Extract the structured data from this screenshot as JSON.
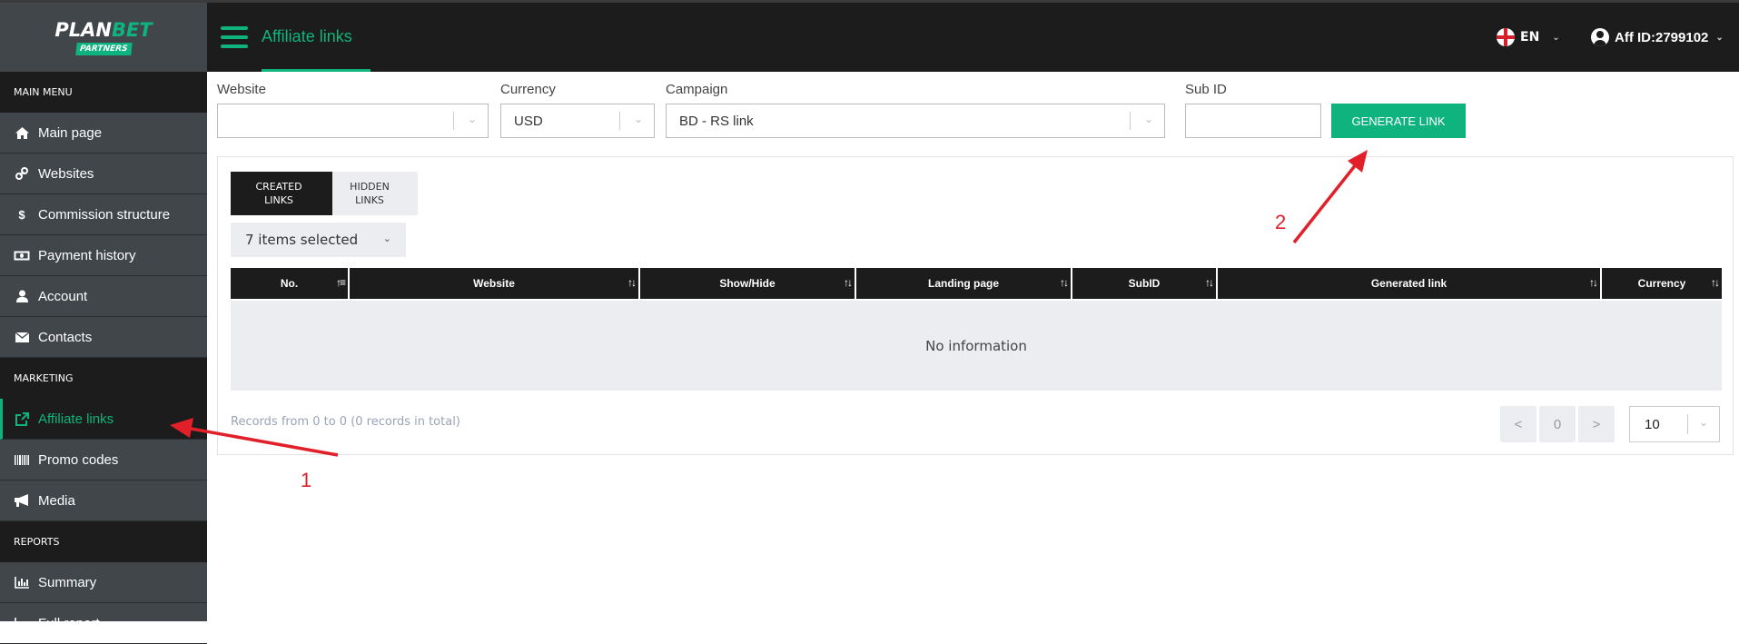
{
  "logo": {
    "plan": "PLAN",
    "bet": "BET",
    "badge": "PARTNERS"
  },
  "sidebar": {
    "sections": [
      {
        "title": "MAIN MENU",
        "items": [
          {
            "label": "Main page",
            "icon": "home-icon"
          },
          {
            "label": "Websites",
            "icon": "link-icon"
          },
          {
            "label": "Commission structure",
            "icon": "dollar-icon"
          },
          {
            "label": "Payment history",
            "icon": "money-bill-icon"
          },
          {
            "label": "Account",
            "icon": "user-icon"
          },
          {
            "label": "Contacts",
            "icon": "envelope-icon"
          }
        ]
      },
      {
        "title": "MARKETING",
        "items": [
          {
            "label": "Affiliate links",
            "icon": "external-link-icon",
            "active": true
          },
          {
            "label": "Promo codes",
            "icon": "barcode-icon"
          },
          {
            "label": "Media",
            "icon": "megaphone-icon"
          }
        ]
      },
      {
        "title": "REPORTS",
        "items": [
          {
            "label": "Summary",
            "icon": "bar-chart-icon"
          },
          {
            "label": "Full report",
            "icon": "chart-icon"
          }
        ]
      }
    ]
  },
  "header": {
    "title": "Affiliate links",
    "language": "EN",
    "user": "Aff ID:2799102"
  },
  "filters": {
    "website": {
      "label": "Website",
      "value": ""
    },
    "currency": {
      "label": "Currency",
      "value": "USD"
    },
    "campaign": {
      "label": "Campaign",
      "value": "BD - RS link"
    },
    "subid": {
      "label": "Sub ID",
      "value": ""
    },
    "generate_button": "GENERATE LINK"
  },
  "tabs": {
    "created": "CREATED LINKS",
    "hidden": "HIDDEN LINKS",
    "active": "created"
  },
  "column_selector": "7 items selected",
  "table": {
    "columns": [
      "No.",
      "Website",
      "Show/Hide",
      "Landing page",
      "SubID",
      "Generated link",
      "Currency"
    ],
    "rows": [],
    "empty_text": "No information"
  },
  "pagination": {
    "records_text": "Records from 0 to 0 (0 records in total)",
    "prev": "<",
    "current": "0",
    "next": ">",
    "per_page": "10"
  },
  "annotations": {
    "step1": "1",
    "step2": "2",
    "color": "#e2202a"
  }
}
